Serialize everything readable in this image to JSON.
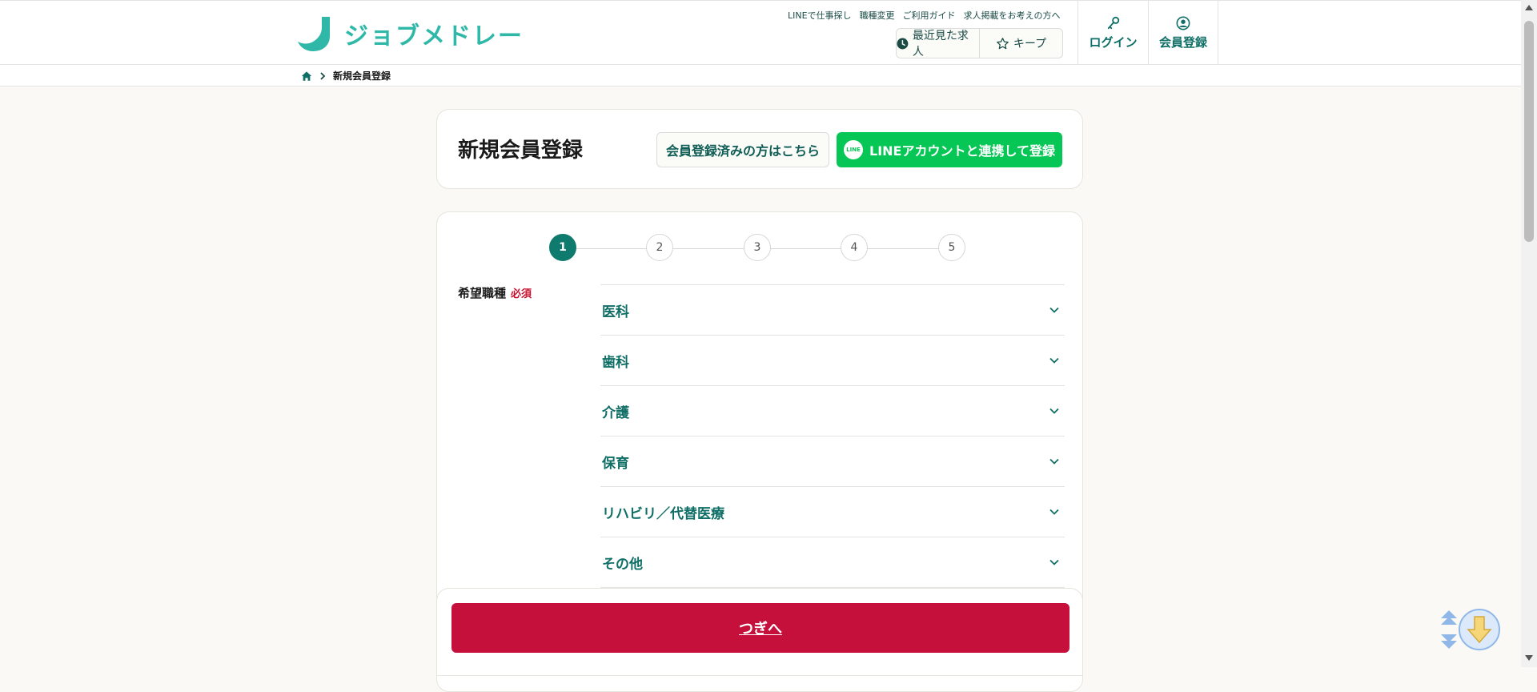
{
  "header": {
    "logo_text": "ジョブメドレー",
    "top_links": [
      "LINEで仕事探し",
      "職種変更",
      "ご利用ガイド",
      "求人掲載をお考えの方へ"
    ],
    "recent_label": "最近見た求人",
    "keep_label": "キープ",
    "login_label": "ログイン",
    "register_label": "会員登録"
  },
  "breadcrumb": {
    "current": "新規会員登録"
  },
  "title_card": {
    "title": "新規会員登録",
    "existing_member_button": "会員登録済みの方はこちら",
    "line_button": "LINEアカウントと連携して登録",
    "line_badge": "LINE"
  },
  "steps": {
    "labels": [
      "1",
      "2",
      "3",
      "4",
      "5"
    ],
    "current": 1
  },
  "form": {
    "field_label": "希望職種",
    "required_label": "必須",
    "categories": [
      "医科",
      "歯科",
      "介護",
      "保育",
      "リハビリ／代替医療",
      "その他"
    ]
  },
  "footer": {
    "next_button": "つぎへ"
  },
  "colors": {
    "brand_teal": "#2fb8a8",
    "dark_teal": "#0f6f66",
    "line_green": "#06c755",
    "next_red": "#c4103a",
    "required_red": "#c8102e"
  }
}
